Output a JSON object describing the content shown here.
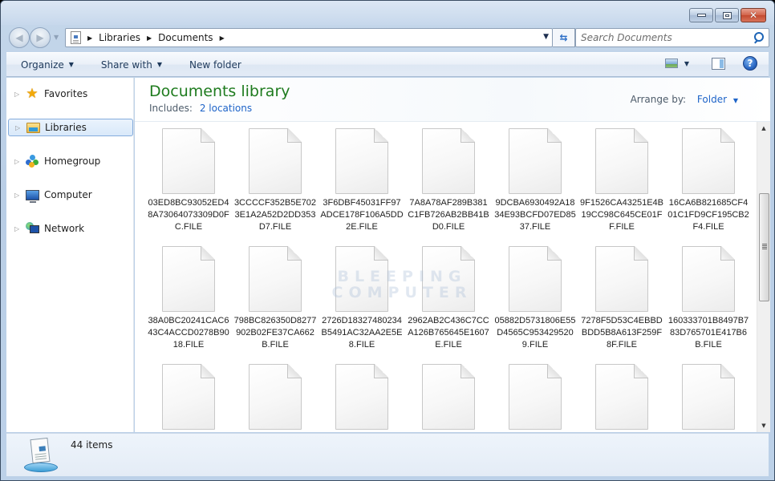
{
  "window": {
    "caption_buttons": {
      "minimize_icon": "minimize-icon",
      "maximize_icon": "maximize-icon",
      "close_glyph": "✕"
    }
  },
  "nav": {
    "back_glyph": "◀",
    "forward_glyph": "▶",
    "recent_glyph": "▼",
    "breadcrumb": [
      "Libraries",
      "Documents"
    ],
    "crumb_separator": "▶",
    "address_dropdown_glyph": "▼",
    "refresh_glyph": "⇆",
    "search": {
      "placeholder": "Search Documents",
      "value": ""
    }
  },
  "toolbar": {
    "organize_label": "Organize",
    "share_with_label": "Share with",
    "new_folder_label": "New folder",
    "dropdown_glyph": "▼",
    "views_arrow_glyph": "▼",
    "help_glyph": "?"
  },
  "sidebar": {
    "items": [
      {
        "label": "Favorites",
        "icon": "star-icon",
        "selected": false
      },
      {
        "label": "Libraries",
        "icon": "libraries-icon",
        "selected": true
      },
      {
        "label": "Homegroup",
        "icon": "homegroup-icon",
        "selected": false
      },
      {
        "label": "Computer",
        "icon": "computer-icon",
        "selected": false
      },
      {
        "label": "Network",
        "icon": "network-icon",
        "selected": false
      }
    ],
    "expander_glyph": "▷",
    "star_glyph": "★"
  },
  "library": {
    "title": "Documents library",
    "includes_label": "Includes:",
    "locations_link": "2 locations",
    "arrange_label": "Arrange by:",
    "arrange_value": "Folder",
    "arrange_arrow": "▼"
  },
  "files": [
    "03ED8BC93052ED48A73064073309D0FC.FILE",
    "3CCCCF352B5E7023E1A2A52D2DD353D7.FILE",
    "3F6DBF45031FF97ADCE178F106A5DD2E.FILE",
    "7A8A78AF289B381C1FB726AB2BB41BD0.FILE",
    "9DCBA6930492A1834E93BCFD07ED8537.FILE",
    "9F1526CA43251E4B19CC98C645CE01FF.FILE",
    "16CA6B821685CF401C1FD9CF195CB2F4.FILE",
    "38A0BC20241CAC643C4ACCD0278B9018.FILE",
    "798BC826350D8277902B02FE37CA662B.FILE",
    "2726D18327480234B5491AC32AA2E5E8.FILE",
    "2962AB2C436C7CCA126B765645E1607E.FILE",
    "05882D5731806E55D4565C9534295209.FILE",
    "7278F5D53C4EBBDBDD5B8A613F259F8F.FILE",
    "160333701B8497B783D765701E417B6B.FILE",
    "",
    "",
    "",
    "",
    "",
    "",
    ""
  ],
  "watermark": {
    "line1": "BLEEPING",
    "line2": "COMPUTER"
  },
  "scrollbar": {
    "up_glyph": "▲",
    "down_glyph": "▼",
    "position_fraction": 0.33
  },
  "details": {
    "item_count": "44 items"
  }
}
